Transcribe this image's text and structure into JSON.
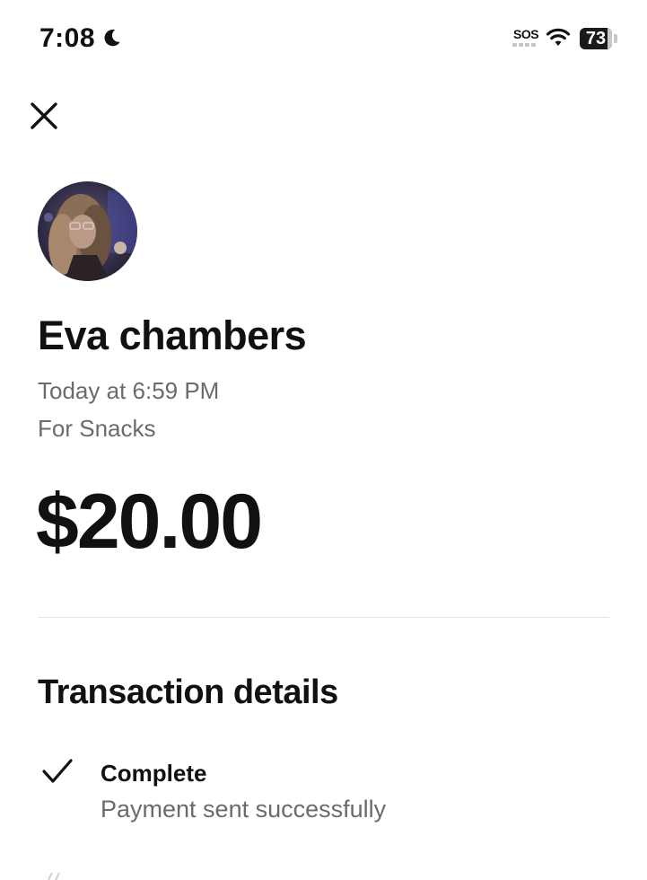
{
  "status_bar": {
    "time": "7:08",
    "focus_icon": "moon-icon",
    "carrier_label": "SOS",
    "battery_percent": "73",
    "battery_level": 0.73
  },
  "header": {
    "close_icon": "close-icon"
  },
  "recipient": {
    "name": "Eva chambers",
    "avatar_icon": "avatar"
  },
  "payment": {
    "timestamp": "Today at 6:59 PM",
    "note": "For Snacks",
    "amount": "$20.00"
  },
  "transaction_details": {
    "section_title": "Transaction details",
    "status": {
      "icon": "checkmark-icon",
      "title": "Complete",
      "subtitle": "Payment sent successfully"
    }
  },
  "colors": {
    "text_primary": "#111111",
    "text_secondary": "#6b6b6b",
    "divider": "#e6e6e6",
    "background": "#ffffff"
  }
}
